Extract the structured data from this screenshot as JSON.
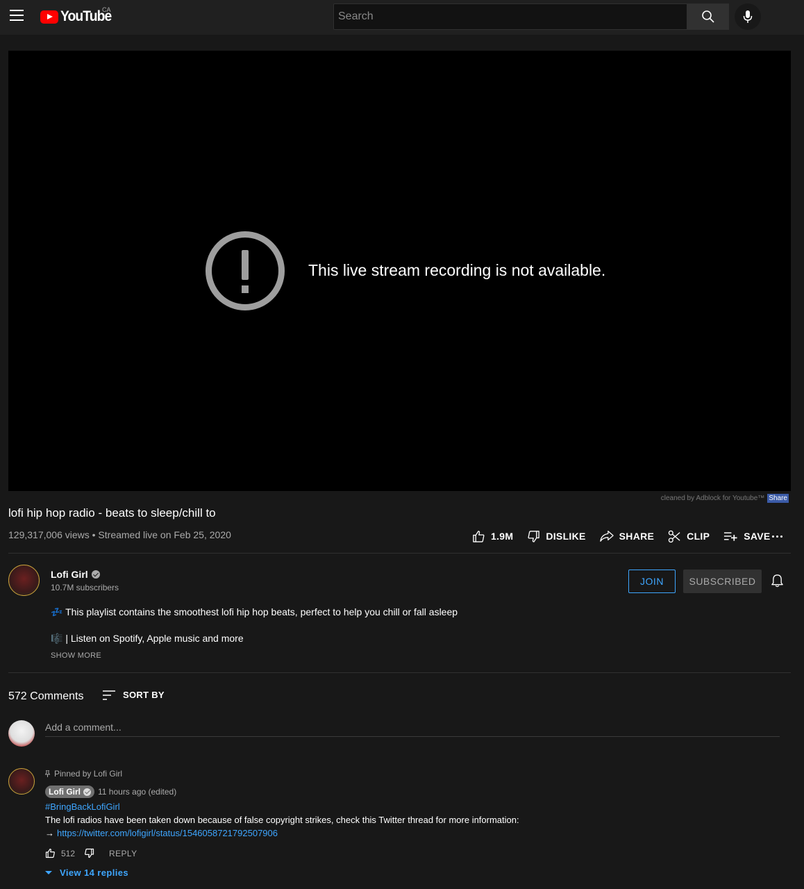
{
  "header": {
    "logo_text": "YouTube",
    "country": "CA",
    "search_placeholder": "Search"
  },
  "player": {
    "error_message": "This live stream recording is not available.",
    "adblock_notice": "cleaned by Adblock for Youtube™",
    "adblock_share": "Share"
  },
  "video": {
    "title": "lofi hip hop radio - beats to sleep/chill to",
    "meta": "129,317,006 views • Streamed live on Feb 25, 2020",
    "actions": {
      "likes": "1.9M",
      "dislike": "DISLIKE",
      "share": "SHARE",
      "clip": "CLIP",
      "save": "SAVE"
    }
  },
  "channel": {
    "name": "Lofi Girl",
    "subscribers": "10.7M subscribers",
    "join_label": "JOIN",
    "subscribed_label": "SUBSCRIBED"
  },
  "description": {
    "line1": "💤 This playlist contains the smoothest lofi hip hop beats, perfect to help you chill or fall asleep",
    "line2": "🎼 | Listen on Spotify, Apple music and more",
    "show_more": "SHOW MORE"
  },
  "comments": {
    "count_label": "572 Comments",
    "sort_label": "SORT BY",
    "add_placeholder": "Add a comment...",
    "pinned": {
      "pinned_label": "Pinned by Lofi Girl",
      "author": "Lofi Girl",
      "time": "11 hours ago (edited)",
      "hashtag": "#BringBackLofiGirl",
      "text": "The lofi radios have been taken down because of false copyright strikes, check this Twitter thread for more information:",
      "arrow": "→",
      "link": "https://twitter.com/lofigirl/status/1546058721792507906",
      "likes": "512",
      "reply_label": "REPLY",
      "view_replies": "View 14 replies"
    }
  },
  "colors": {
    "background": "#181818",
    "topbar": "#202020",
    "accent_blue": "#3ea6ff",
    "logo_red": "#ff0000"
  }
}
